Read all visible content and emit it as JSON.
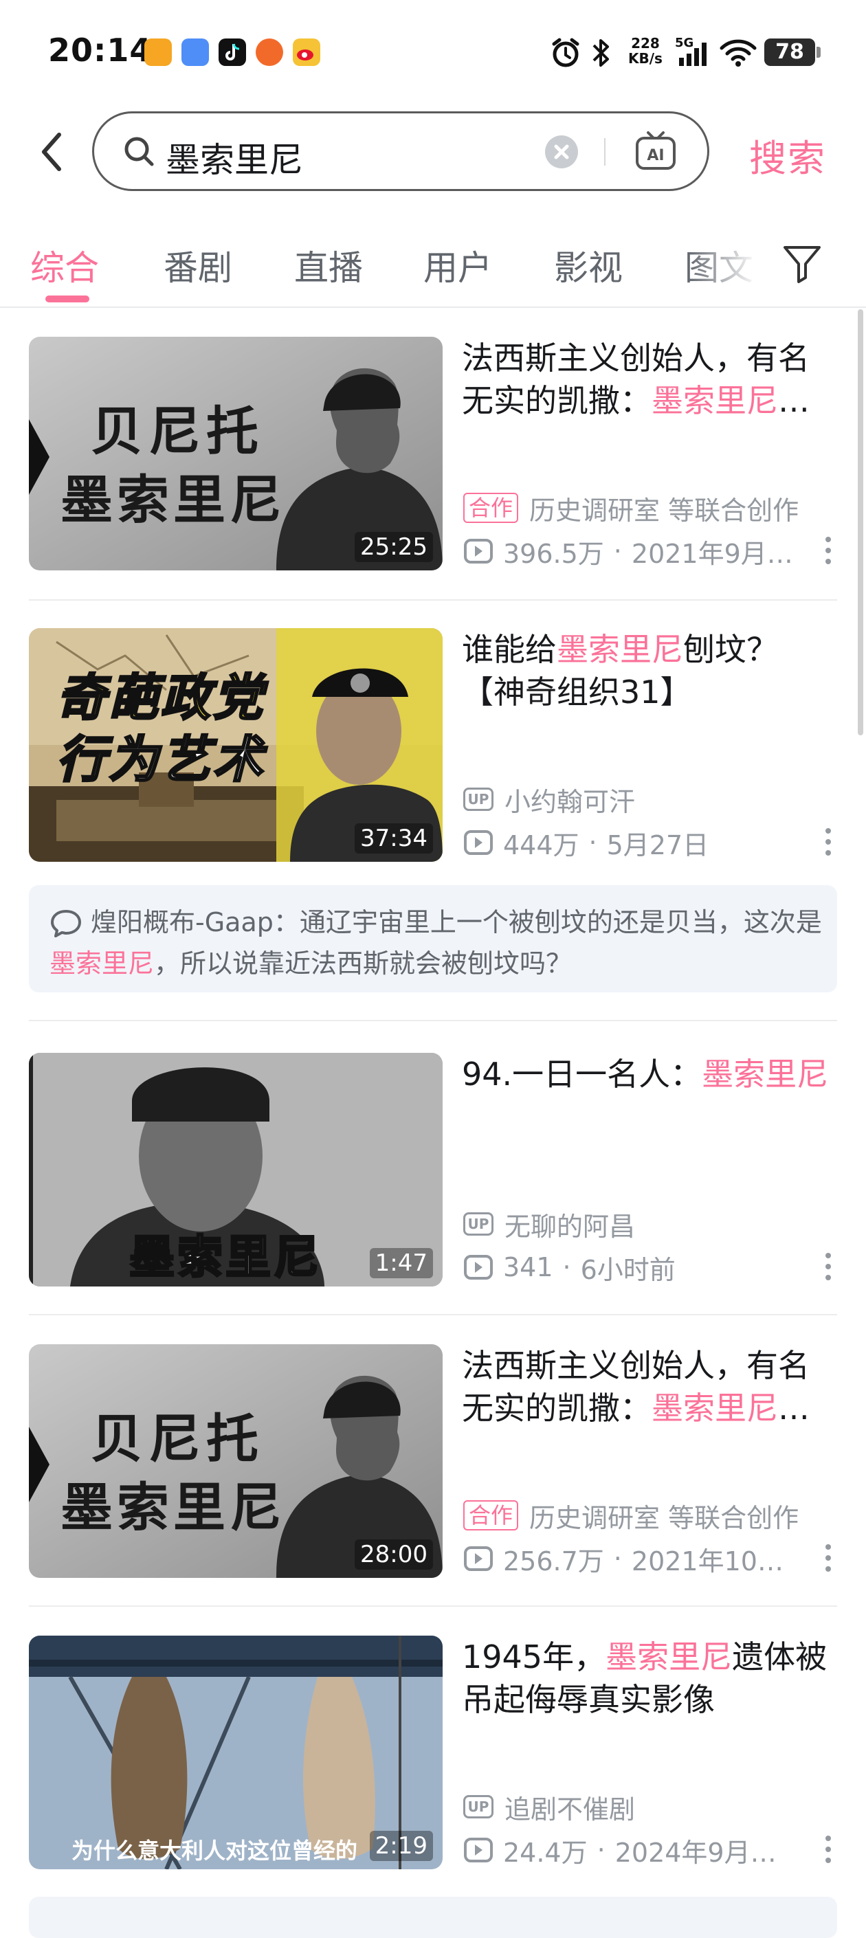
{
  "status_bar": {
    "time": "20:14",
    "net_speed_value": "228",
    "net_speed_unit": "KB/s",
    "battery": "78",
    "network": "5G",
    "icons": [
      "alarm-icon",
      "bluetooth-icon",
      "signal-icon",
      "wifi-icon",
      "battery-icon"
    ],
    "app_icons": [
      "notes-app-icon",
      "cloud-app-icon",
      "tiktok-app-icon",
      "pumpkin-app-icon",
      "weibo-app-icon"
    ]
  },
  "search": {
    "query": "墨索里尼",
    "button_label": "搜索"
  },
  "tabs": [
    {
      "label": "综合",
      "active": true
    },
    {
      "label": "番剧",
      "active": false
    },
    {
      "label": "直播",
      "active": false
    },
    {
      "label": "用户",
      "active": false
    },
    {
      "label": "影视",
      "active": false
    },
    {
      "label": "图文",
      "active": false
    }
  ],
  "videos": [
    {
      "title_before": "法西斯主义创始人，有名无实的凯撒：",
      "title_highlight": "墨索里尼",
      "title_after": "…",
      "thumb_text_1": "贝尼托",
      "thumb_text_2": "墨索里尼",
      "duration": "25:25",
      "badge": "合作",
      "author": "历史调研室 等联合创作",
      "views": "396.5万",
      "date": "2021年9月…"
    },
    {
      "title_before": "谁能给",
      "title_highlight": "墨索里尼",
      "title_after": "刨坟？【神奇组织31】",
      "thumb_text_1": "奇葩政党",
      "thumb_text_2": "行为艺术",
      "duration": "37:34",
      "badge": "UP",
      "author": "小约翰可汗",
      "views": "444万",
      "date": "5月27日"
    },
    {
      "title_before": "94.一日一名人：",
      "title_highlight": "墨索里尼",
      "title_after": "",
      "thumb_text_1": "墨索里尼",
      "duration": "1:47",
      "badge": "UP",
      "author": "无聊的阿昌",
      "views": "341",
      "date": "6小时前"
    },
    {
      "title_before": "法西斯主义创始人，有名无实的凯撒：",
      "title_highlight": "墨索里尼",
      "title_after": "…",
      "thumb_text_1": "贝尼托",
      "thumb_text_2": "墨索里尼",
      "duration": "28:00",
      "badge": "合作",
      "author": "历史调研室 等联合创作",
      "views": "256.7万",
      "date": "2021年10…"
    },
    {
      "title_before": "1945年，",
      "title_highlight": "墨索里尼",
      "title_after": "遗体被吊起侮辱真实影像",
      "thumb_caption": "为什么意大利人对这位曾经的",
      "duration": "2:19",
      "badge": "UP",
      "author": "追剧不催剧",
      "views": "24.4万",
      "date": "2024年9月…"
    }
  ],
  "hot_comment": {
    "user": "煌阳概布-Gaap",
    "text_before": "：通辽宇宙里上一个被刨坟的还是贝当，这次是",
    "text_highlight": "墨索里尼",
    "text_after": "，所以说靠近法西斯就会被刨坟吗？"
  },
  "colors": {
    "accent": "#fb7299",
    "text_primary": "#18191c",
    "text_secondary": "#9499a0"
  }
}
